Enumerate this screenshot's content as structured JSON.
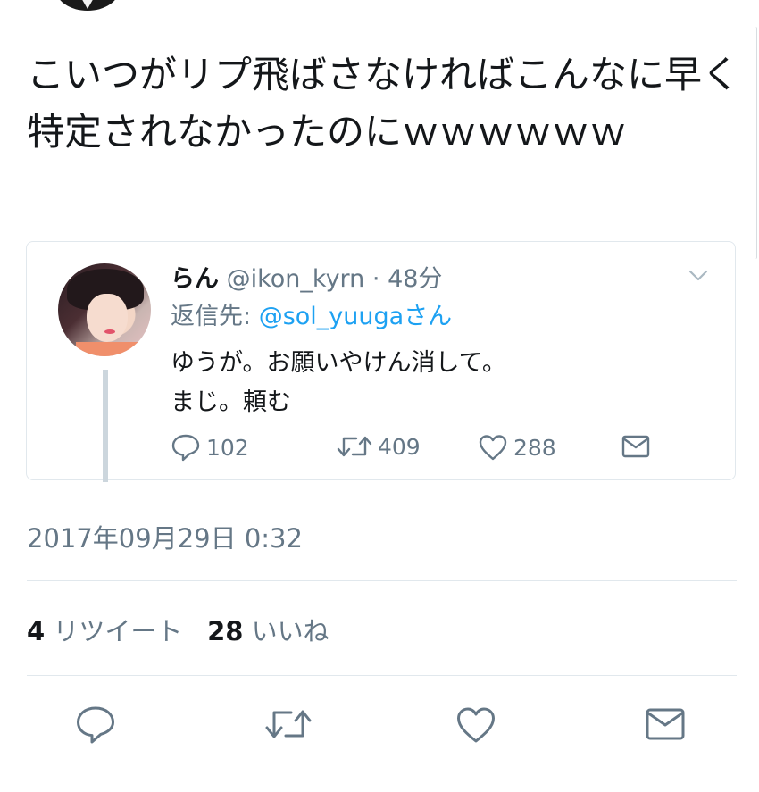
{
  "tweet": {
    "text": "こいつがリプ飛ばさなければこんなに早く特定されなかったのにｗｗｗｗｗｗ"
  },
  "quoted_tweet": {
    "name": "らん",
    "handle": "@ikon_kyrn",
    "separator": "·",
    "time": "48分",
    "reply_prefix": "返信先: ",
    "reply_target": "@sol_yuuga",
    "reply_suffix": "さん",
    "body_lines": [
      "ゆうが。お願いやけん消して。",
      "まじ。頼む"
    ],
    "replies": "102",
    "retweets": "409",
    "likes": "288"
  },
  "timestamp": "2017年09月29日 0:32",
  "stats": {
    "retweet_count": "4",
    "retweet_label": "リツイート",
    "like_count": "28",
    "like_label": "いいね"
  },
  "icons": {
    "reply": "reply-icon",
    "retweet": "retweet-icon",
    "like": "heart-icon",
    "dm": "mail-icon",
    "menu": "chevron-down-icon"
  },
  "colors": {
    "link": "#1da1f2",
    "secondary": "#657786",
    "primary_text": "#14171a",
    "border": "#e1e8ed"
  }
}
